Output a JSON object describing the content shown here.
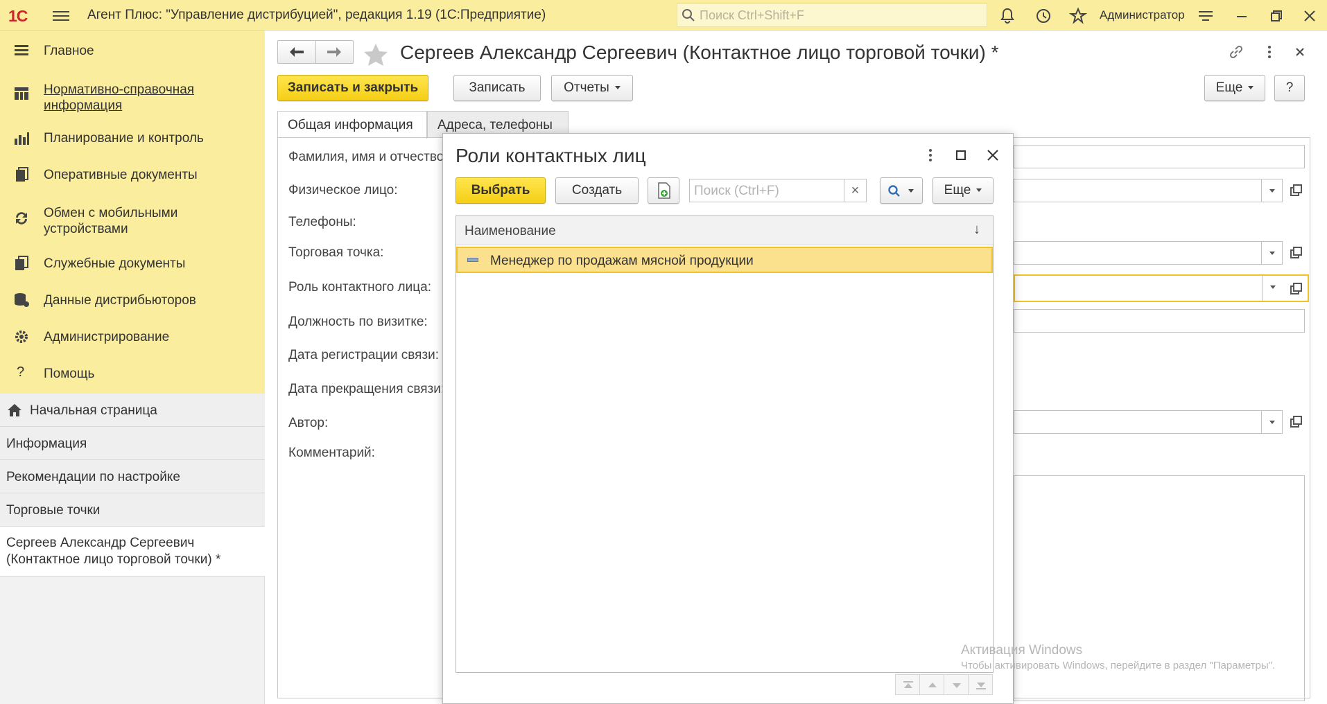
{
  "app": {
    "logo": "1С",
    "title": "Агент Плюс: \"Управление дистрибуцией\", редакция 1.19  (1С:Предприятие)",
    "search_placeholder": "Поиск Ctrl+Shift+F",
    "user": "Администратор"
  },
  "sidebar": {
    "items": [
      {
        "label": "Главное",
        "icon": "list-icon"
      },
      {
        "label": "Нормативно-справочная информация",
        "icon": "table-icon"
      },
      {
        "label": "Планирование и контроль",
        "icon": "chart-icon"
      },
      {
        "label": "Оперативные документы",
        "icon": "documents-icon"
      },
      {
        "label": "Обмен с мобильными устройствами",
        "icon": "sync-icon"
      },
      {
        "label": "Служебные документы",
        "icon": "service-docs-icon"
      },
      {
        "label": "Данные дистрибьюторов",
        "icon": "database-icon"
      },
      {
        "label": "Администрирование",
        "icon": "gear-icon"
      },
      {
        "label": "Помощь",
        "icon": "question-icon"
      }
    ],
    "open_windows": [
      {
        "label": "Начальная страница"
      },
      {
        "label": "Информация"
      },
      {
        "label": "Рекомендации по настройке"
      },
      {
        "label": "Торговые точки"
      },
      {
        "label": "Сергеев Александр Сергеевич (Контактное лицо торговой точки) *"
      }
    ]
  },
  "form": {
    "title": "Сергеев Александр Сергеевич (Контактное лицо торговой точки) *",
    "buttons": {
      "save_close": "Записать и закрыть",
      "save": "Записать",
      "reports": "Отчеты",
      "more": "Еще",
      "help": "?"
    },
    "tabs": [
      {
        "label": "Общая информация",
        "active": true
      },
      {
        "label": "Адреса, телефоны",
        "active": false
      }
    ],
    "fields": {
      "fio": "Фамилия, имя и отчество:",
      "person": "Физическое лицо:",
      "phones": "Телефоны:",
      "outlet": "Торговая точка:",
      "role": "Роль контактного лица:",
      "position": "Должность по визитке:",
      "reg_date": "Дата регистрации связи:",
      "end_date": "Дата прекращения связи:",
      "author": "Автор:",
      "comment": "Комментарий:"
    }
  },
  "dialog": {
    "title": "Роли контактных лиц",
    "buttons": {
      "select": "Выбрать",
      "create": "Создать",
      "more": "Еще"
    },
    "search_placeholder": "Поиск (Ctrl+F)",
    "clear": "×",
    "column": "Наименование",
    "sort": "↓",
    "rows": [
      {
        "name": "Менеджер по продажам мясной продукции",
        "selected": true
      }
    ]
  },
  "watermark": {
    "title": "Активация Windows",
    "text": "Чтобы активировать Windows, перейдите в раздел \"Параметры\"."
  },
  "colors": {
    "accent_yellow": "#f5cf16",
    "panel_yellow": "#fbed9e",
    "selection": "#fbe18d",
    "logo_red": "#d2232a"
  }
}
